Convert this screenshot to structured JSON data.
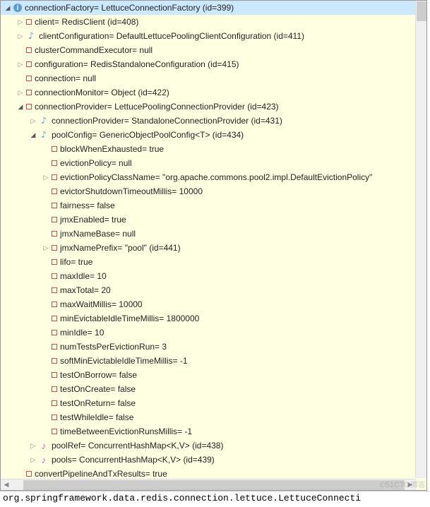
{
  "root": {
    "label": "connectionFactory= LettuceConnectionFactory  (id=399)",
    "children": [
      {
        "icon": "red",
        "toggle": "collapsed",
        "indent": 1,
        "label": "client= RedisClient  (id=408)"
      },
      {
        "icon": "blue",
        "toggle": "collapsed",
        "indent": 1,
        "label": "clientConfiguration= DefaultLettucePoolingClientConfiguration  (id=411)"
      },
      {
        "icon": "red",
        "toggle": "none",
        "indent": 1,
        "label": "clusterCommandExecutor= null"
      },
      {
        "icon": "red",
        "toggle": "collapsed",
        "indent": 1,
        "label": "configuration= RedisStandaloneConfiguration  (id=415)"
      },
      {
        "icon": "red",
        "toggle": "none",
        "indent": 1,
        "label": "connection= null"
      },
      {
        "icon": "red",
        "toggle": "collapsed",
        "indent": 1,
        "label": "connectionMonitor= Object  (id=422)"
      },
      {
        "icon": "red",
        "toggle": "expanded",
        "indent": 1,
        "label": "connectionProvider= LettucePoolingConnectionProvider  (id=423)"
      },
      {
        "icon": "blue",
        "toggle": "collapsed",
        "indent": 2,
        "label": "connectionProvider= StandaloneConnectionProvider  (id=431)"
      },
      {
        "icon": "blue",
        "toggle": "expanded",
        "indent": 2,
        "label": "poolConfig= GenericObjectPoolConfig<T>  (id=434)"
      },
      {
        "icon": "red",
        "toggle": "none",
        "indent": 3,
        "label": "blockWhenExhausted= true"
      },
      {
        "icon": "red",
        "toggle": "none",
        "indent": 3,
        "label": "evictionPolicy= null"
      },
      {
        "icon": "red",
        "toggle": "collapsed",
        "indent": 3,
        "label": "evictionPolicyClassName= \"org.apache.commons.pool2.impl.DefaultEvictionPolicy\""
      },
      {
        "icon": "red",
        "toggle": "none",
        "indent": 3,
        "label": "evictorShutdownTimeoutMillis= 10000"
      },
      {
        "icon": "red",
        "toggle": "none",
        "indent": 3,
        "label": "fairness= false"
      },
      {
        "icon": "red",
        "toggle": "none",
        "indent": 3,
        "label": "jmxEnabled= true"
      },
      {
        "icon": "red",
        "toggle": "none",
        "indent": 3,
        "label": "jmxNameBase= null"
      },
      {
        "icon": "red",
        "toggle": "collapsed",
        "indent": 3,
        "label": "jmxNamePrefix= \"pool\"  (id=441)"
      },
      {
        "icon": "red",
        "toggle": "none",
        "indent": 3,
        "label": "lifo= true"
      },
      {
        "icon": "red",
        "toggle": "none",
        "indent": 3,
        "label": "maxIdle= 10"
      },
      {
        "icon": "red",
        "toggle": "none",
        "indent": 3,
        "label": "maxTotal= 20"
      },
      {
        "icon": "red",
        "toggle": "none",
        "indent": 3,
        "label": "maxWaitMillis= 10000"
      },
      {
        "icon": "red",
        "toggle": "none",
        "indent": 3,
        "label": "minEvictableIdleTimeMillis= 1800000"
      },
      {
        "icon": "red",
        "toggle": "none",
        "indent": 3,
        "label": "minIdle= 10"
      },
      {
        "icon": "red",
        "toggle": "none",
        "indent": 3,
        "label": "numTestsPerEvictionRun= 3"
      },
      {
        "icon": "red",
        "toggle": "none",
        "indent": 3,
        "label": "softMinEvictableIdleTimeMillis= -1"
      },
      {
        "icon": "red",
        "toggle": "none",
        "indent": 3,
        "label": "testOnBorrow= false"
      },
      {
        "icon": "red",
        "toggle": "none",
        "indent": 3,
        "label": "testOnCreate= false"
      },
      {
        "icon": "red",
        "toggle": "none",
        "indent": 3,
        "label": "testOnReturn= false"
      },
      {
        "icon": "red",
        "toggle": "none",
        "indent": 3,
        "label": "testWhileIdle= false"
      },
      {
        "icon": "red",
        "toggle": "none",
        "indent": 3,
        "label": "timeBetweenEvictionRunsMillis= -1"
      },
      {
        "icon": "purple",
        "toggle": "collapsed",
        "indent": 2,
        "label": "poolRef= ConcurrentHashMap<K,V>  (id=438)"
      },
      {
        "icon": "purple",
        "toggle": "collapsed",
        "indent": 2,
        "label": "pools= ConcurrentHashMap<K,V>  (id=439)"
      },
      {
        "icon": "red",
        "toggle": "none",
        "indent": 1,
        "label": "convertPipelineAndTxResults= true"
      }
    ]
  },
  "status": "org.springframework.data.redis.connection.lettuce.LettuceConnecti",
  "watermark": "©51CTO博客"
}
